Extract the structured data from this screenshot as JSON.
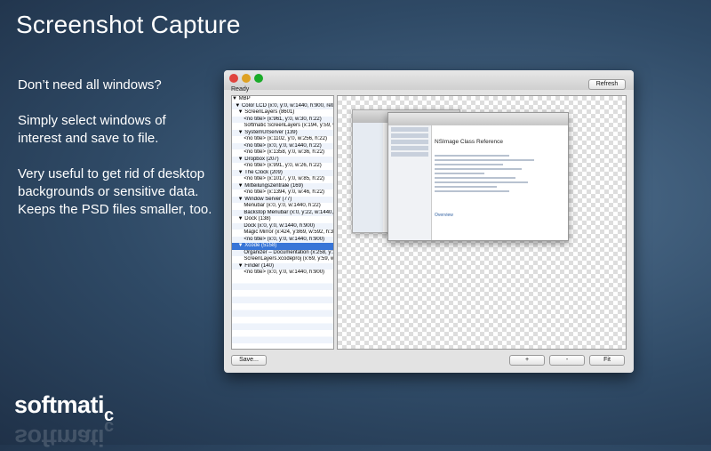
{
  "headline": "Screenshot Capture",
  "pitch": [
    "Don’t need all windows?",
    "Simply select windows of interest and save to file.",
    "Very useful to get rid of desktop backgrounds or sensitive data. Keeps the PSD files smaller, too."
  ],
  "brand": {
    "main": "softmati",
    "sub": "c"
  },
  "window": {
    "status": "Ready",
    "refresh_label": "Refresh",
    "save_label": "Save...",
    "plus_label": "+",
    "minus_label": "-",
    "fit_label": "Fit",
    "tree": [
      "▼ MBP",
      "  ▼ Color LCD (x:0, y:0, w:1440, h:900, retina, main)",
      "    ▼ ScreenLayers (8601)",
      "        <no title> (x:961, y:0, w:30, h:22)",
      "        Softmatic ScreenLayers (x:194, y:59, w:102...",
      "    ▼ SystemUIServer (139)",
      "        <no title> (x:1102, y:0, w:256, h:22)",
      "        <no title> (x:0, y:0, w:1440, h:22)",
      "        <no title> (x:1358, y:0, w:36, h:22)",
      "    ▼ Dropbox (207)",
      "        <no title> (x:991, y:0, w:26, h:22)",
      "    ▼ The Clock (209)",
      "        <no title> (x:1017, y:0, w:85, h:22)",
      "    ▼ Mitteilungszentrale (169)",
      "        <no title> (x:1394, y:0, w:46, h:22)",
      "    ▼ Window Server (77)",
      "        Menubar (x:0, y:0, w:1440, h:22)",
      "        Backstop Menubar (x:0, y:22, w:1440, h:14)",
      "    ▼ Dock (138)",
      "        Dock (x:0, y:0, w:1440, h:900)",
      "        Magic Mirror (x:424, y:869, w:592, h:31)",
      "        <no title> (x:0, y:0, w:1440, h:900)",
      "    ▼ Xcode (5158)",
      "        Organizer – Documentation (x:258, y:102,...",
      "        ScreenLayers.xcodeproj (x:69, y:59, w:1169...",
      "    ▼ Finder (140)",
      "        <no title> (x:0, y:0, w:1440, h:900)"
    ],
    "selected_index": 22,
    "preview": {
      "doc_title": "NSImage Class Reference",
      "overview": "Overview"
    }
  }
}
